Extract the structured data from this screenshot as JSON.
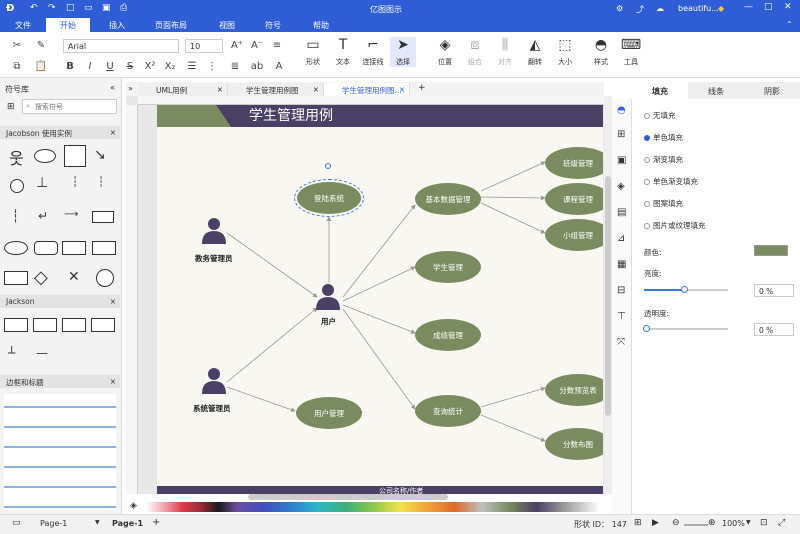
{
  "app": {
    "title": "亿图图示",
    "user": "beautifu..."
  },
  "menu": [
    "文件",
    "开始",
    "插入",
    "页面布局",
    "视图",
    "符号",
    "帮助"
  ],
  "ribbon": {
    "font": "Arial",
    "font_size": "10",
    "big_buttons": [
      "形状",
      "文本",
      "连接线",
      "选择",
      "位置",
      "组合",
      "对齐",
      "翻转",
      "大小",
      "样式",
      "工具"
    ]
  },
  "library": {
    "title": "符号库",
    "search_placeholder": "搜索符号",
    "sections": [
      "Jacobson 使用实例",
      "Jackson",
      "边框和标题"
    ]
  },
  "tabs": [
    "UML用例",
    "学生管理用例图",
    "学生管理用例图..."
  ],
  "diagram": {
    "title": "学生管理用例",
    "footer": "公司名称/作者",
    "actors": [
      "教务管理员",
      "用户",
      "系统管理员"
    ],
    "nodes": [
      "登陆系统",
      "基本数据管理",
      "学生管理",
      "成绩管理",
      "查询统计",
      "用户管理",
      "班级管理",
      "课程管理",
      "小组管理",
      "分数预览表",
      "分数布图"
    ]
  },
  "right_panel": {
    "tabs": [
      "填充",
      "线条",
      "阴影"
    ],
    "fill_options": [
      "无填充",
      "单色填充",
      "渐变填充",
      "单色渐变填充",
      "图案填充",
      "图片或纹理填充"
    ],
    "color_label": "颜色:",
    "brightness_label": "亮度:",
    "brightness_value": "0 %",
    "transparency_label": "透明度:",
    "transparency_value": "0 %",
    "fill_color": "#7a8c5f"
  },
  "status": {
    "page_select": "Page-1",
    "page_tab": "Page-1",
    "shape_id": "形状 ID： 147",
    "zoom": "100%"
  },
  "colors": {
    "accent": "#2f5dd6",
    "node": "#7a8c5f",
    "header": "#4a4066"
  }
}
